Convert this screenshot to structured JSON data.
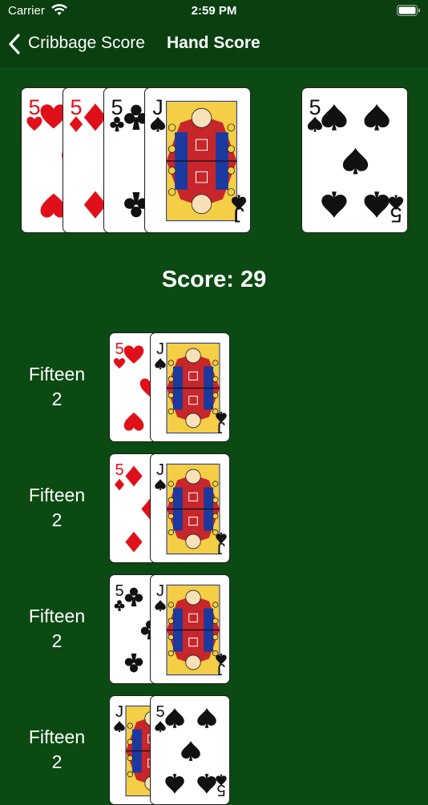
{
  "status_bar": {
    "carrier": "Carrier",
    "time": "2:59 PM"
  },
  "nav": {
    "back_label": "Cribbage Score",
    "title": "Hand Score"
  },
  "hand": {
    "cards": [
      {
        "rank": "5",
        "suit": "hearts"
      },
      {
        "rank": "5",
        "suit": "diamonds"
      },
      {
        "rank": "5",
        "suit": "clubs"
      },
      {
        "rank": "J",
        "suit": "spades"
      }
    ],
    "starter": {
      "rank": "5",
      "suit": "spades"
    }
  },
  "score_text": "Score: 29",
  "combinations": [
    {
      "type": "Fifteen",
      "points": "2",
      "cards": [
        {
          "rank": "5",
          "suit": "hearts"
        },
        {
          "rank": "J",
          "suit": "spades"
        }
      ]
    },
    {
      "type": "Fifteen",
      "points": "2",
      "cards": [
        {
          "rank": "5",
          "suit": "diamonds"
        },
        {
          "rank": "J",
          "suit": "spades"
        }
      ]
    },
    {
      "type": "Fifteen",
      "points": "2",
      "cards": [
        {
          "rank": "5",
          "suit": "clubs"
        },
        {
          "rank": "J",
          "suit": "spades"
        }
      ]
    },
    {
      "type": "Fifteen",
      "points": "2",
      "cards": [
        {
          "rank": "J",
          "suit": "spades"
        },
        {
          "rank": "5",
          "suit": "spades"
        }
      ]
    }
  ],
  "colors": {
    "felt": "#0b4a12",
    "bar": "#0a3f0f",
    "red_suit": "#e0101a",
    "black_suit": "#111111"
  }
}
